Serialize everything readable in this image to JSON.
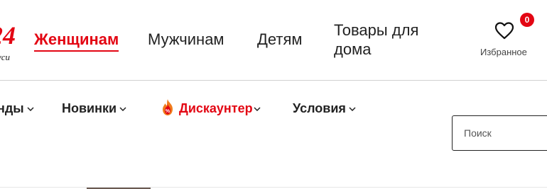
{
  "logo": {
    "number": "24",
    "subtitle": "уси"
  },
  "top_tabs": [
    {
      "label": "Женщинам",
      "active": true
    },
    {
      "label": "Мужчинам",
      "active": false
    },
    {
      "label": "Детям",
      "active": false
    },
    {
      "label": "Товары для\nдома",
      "active": false
    }
  ],
  "favorites": {
    "count": "0",
    "label": "Избранное",
    "icon": "heart-icon"
  },
  "nav": [
    {
      "label": "нды",
      "icon": "chevron-down-icon"
    },
    {
      "label": "Новинки",
      "icon": "chevron-down-icon"
    },
    {
      "label": "Дискаунтер",
      "icon": "chevron-down-icon",
      "badge_icon": "fire-discount-icon",
      "highlight": true
    },
    {
      "label": "Условия",
      "icon": "chevron-down-icon"
    }
  ],
  "search": {
    "placeholder": "Поиск",
    "value": ""
  },
  "colors": {
    "accent": "#e30613",
    "text": "#222222",
    "divider": "#d0d0d0"
  }
}
